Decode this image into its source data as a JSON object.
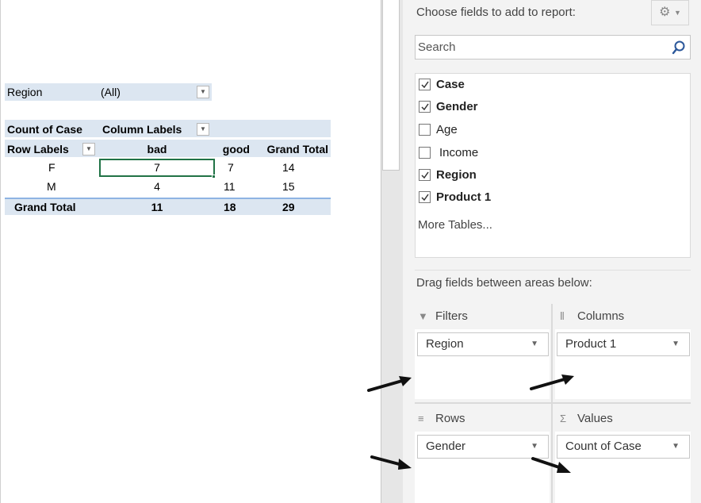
{
  "pivot": {
    "filter_label": "Region",
    "filter_value": "(All)",
    "count_label": "Count of Case",
    "column_labels": "Column Labels",
    "row_labels": "Row Labels",
    "col_headers": [
      "bad",
      "good",
      "Grand Total"
    ],
    "rows": [
      {
        "label": "F",
        "values": [
          "7",
          "7",
          "14"
        ]
      },
      {
        "label": "M",
        "values": [
          "4",
          "11",
          "15"
        ]
      }
    ],
    "grand_total": {
      "label": "Grand Total",
      "values": [
        "11",
        "18",
        "29"
      ]
    },
    "dropdown_glyph": "▼"
  },
  "pane": {
    "title": "Choose fields to add to report:",
    "search_placeholder": "Search",
    "fields": [
      {
        "label": "Case",
        "checked": true
      },
      {
        "label": "Gender",
        "checked": true
      },
      {
        "label": "Age",
        "checked": false
      },
      {
        "label": "Income",
        "checked": false
      },
      {
        "label": "Region",
        "checked": true
      },
      {
        "label": "Product 1",
        "checked": true
      }
    ],
    "more_tables": "More Tables...",
    "drag_title": "Drag fields between areas below:",
    "areas": {
      "filters": {
        "title": "Filters",
        "item": "Region"
      },
      "columns": {
        "title": "Columns",
        "item": "Product 1"
      },
      "rows": {
        "title": "Rows",
        "item": "Gender"
      },
      "values": {
        "title": "Values",
        "item": "Count of Case"
      }
    }
  },
  "icons": {
    "gear": "gear-icon",
    "search": "search-icon",
    "filter": "filter-icon",
    "columns": "columns-icon",
    "rows": "rows-icon",
    "sigma": "sigma-icon"
  },
  "colors": {
    "pivot_header_bg": "#dce6f1",
    "selected_cell_border": "#217346",
    "pane_bg": "#f3f3f3"
  }
}
